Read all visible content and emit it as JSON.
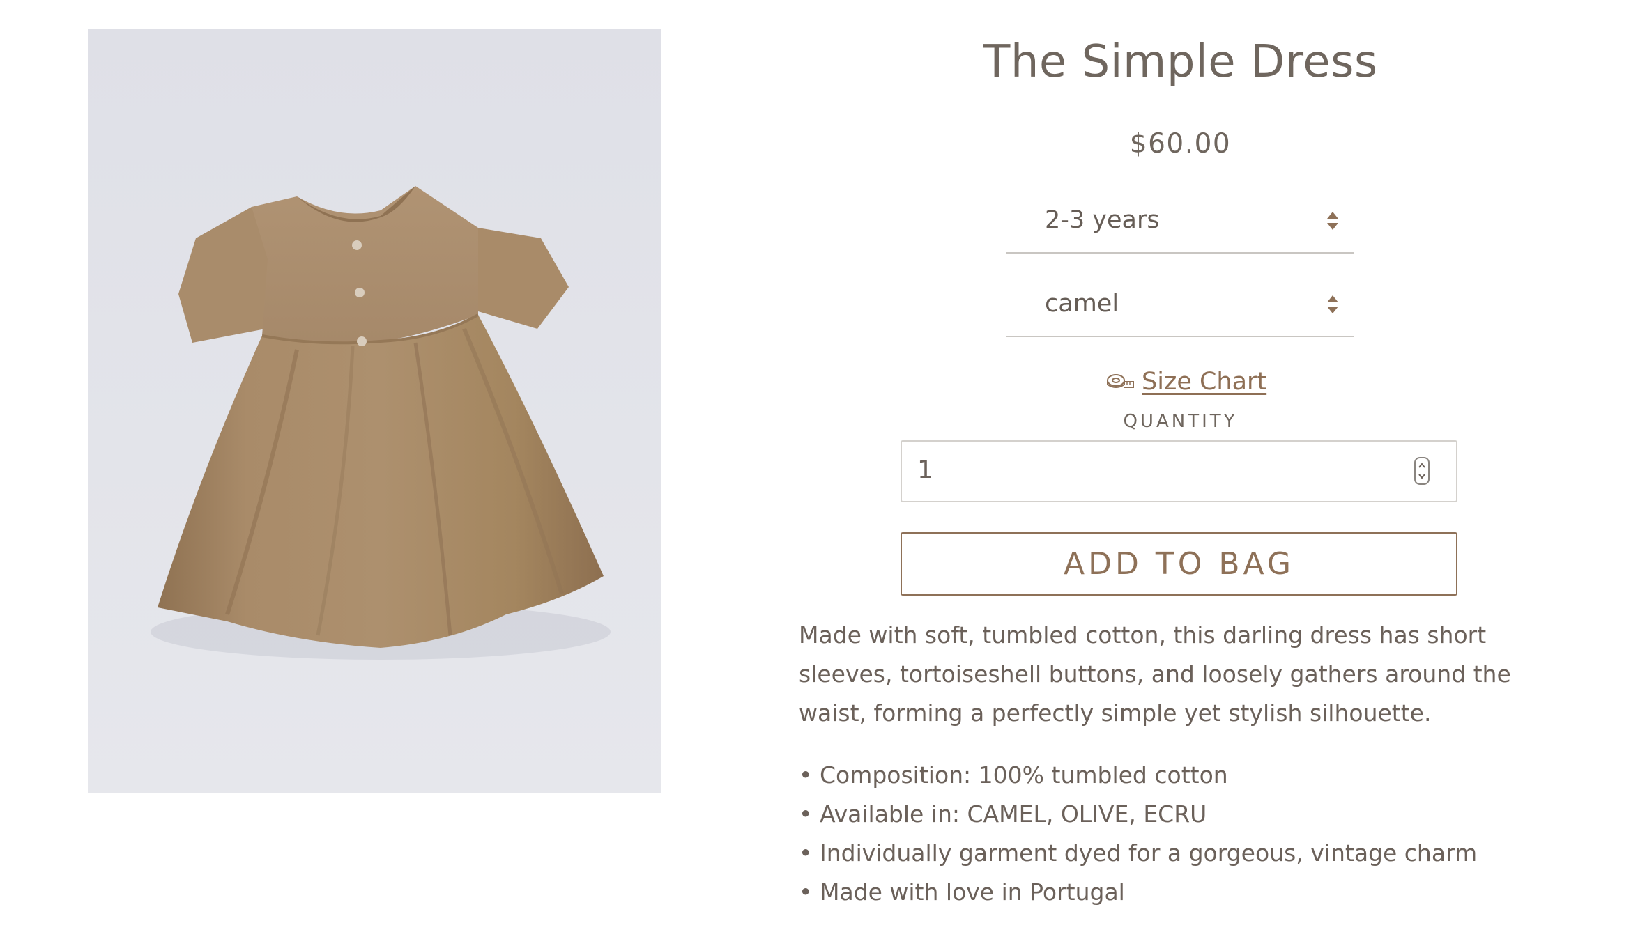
{
  "product": {
    "title": "The Simple Dress",
    "price": "$60.00",
    "image_alt": "camel-colored short-sleeve dress"
  },
  "options": {
    "size": {
      "selected": "2-3 years"
    },
    "color": {
      "selected": "camel"
    }
  },
  "size_chart": {
    "icon": "tape-measure-icon",
    "label": "Size Chart"
  },
  "quantity": {
    "label": "QUANTITY",
    "value": "1"
  },
  "add_to_bag": {
    "label": "ADD TO BAG"
  },
  "description": "Made with soft, tumbled cotton, this darling dress has short sleeves, tortoiseshell buttons, and loosely gathers around the waist, forming a perfectly simple yet stylish silhouette.",
  "features": [
    "Composition: 100% tumbled cotton",
    "Available in: CAMEL, OLIVE, ECRU",
    "Individually garment dyed for a gorgeous, vintage charm",
    "Made with love in Portugal"
  ],
  "colors": {
    "text": "#6b615a",
    "accent": "#8e7158",
    "link": "#8e6f55",
    "dress": "#a88a68"
  }
}
